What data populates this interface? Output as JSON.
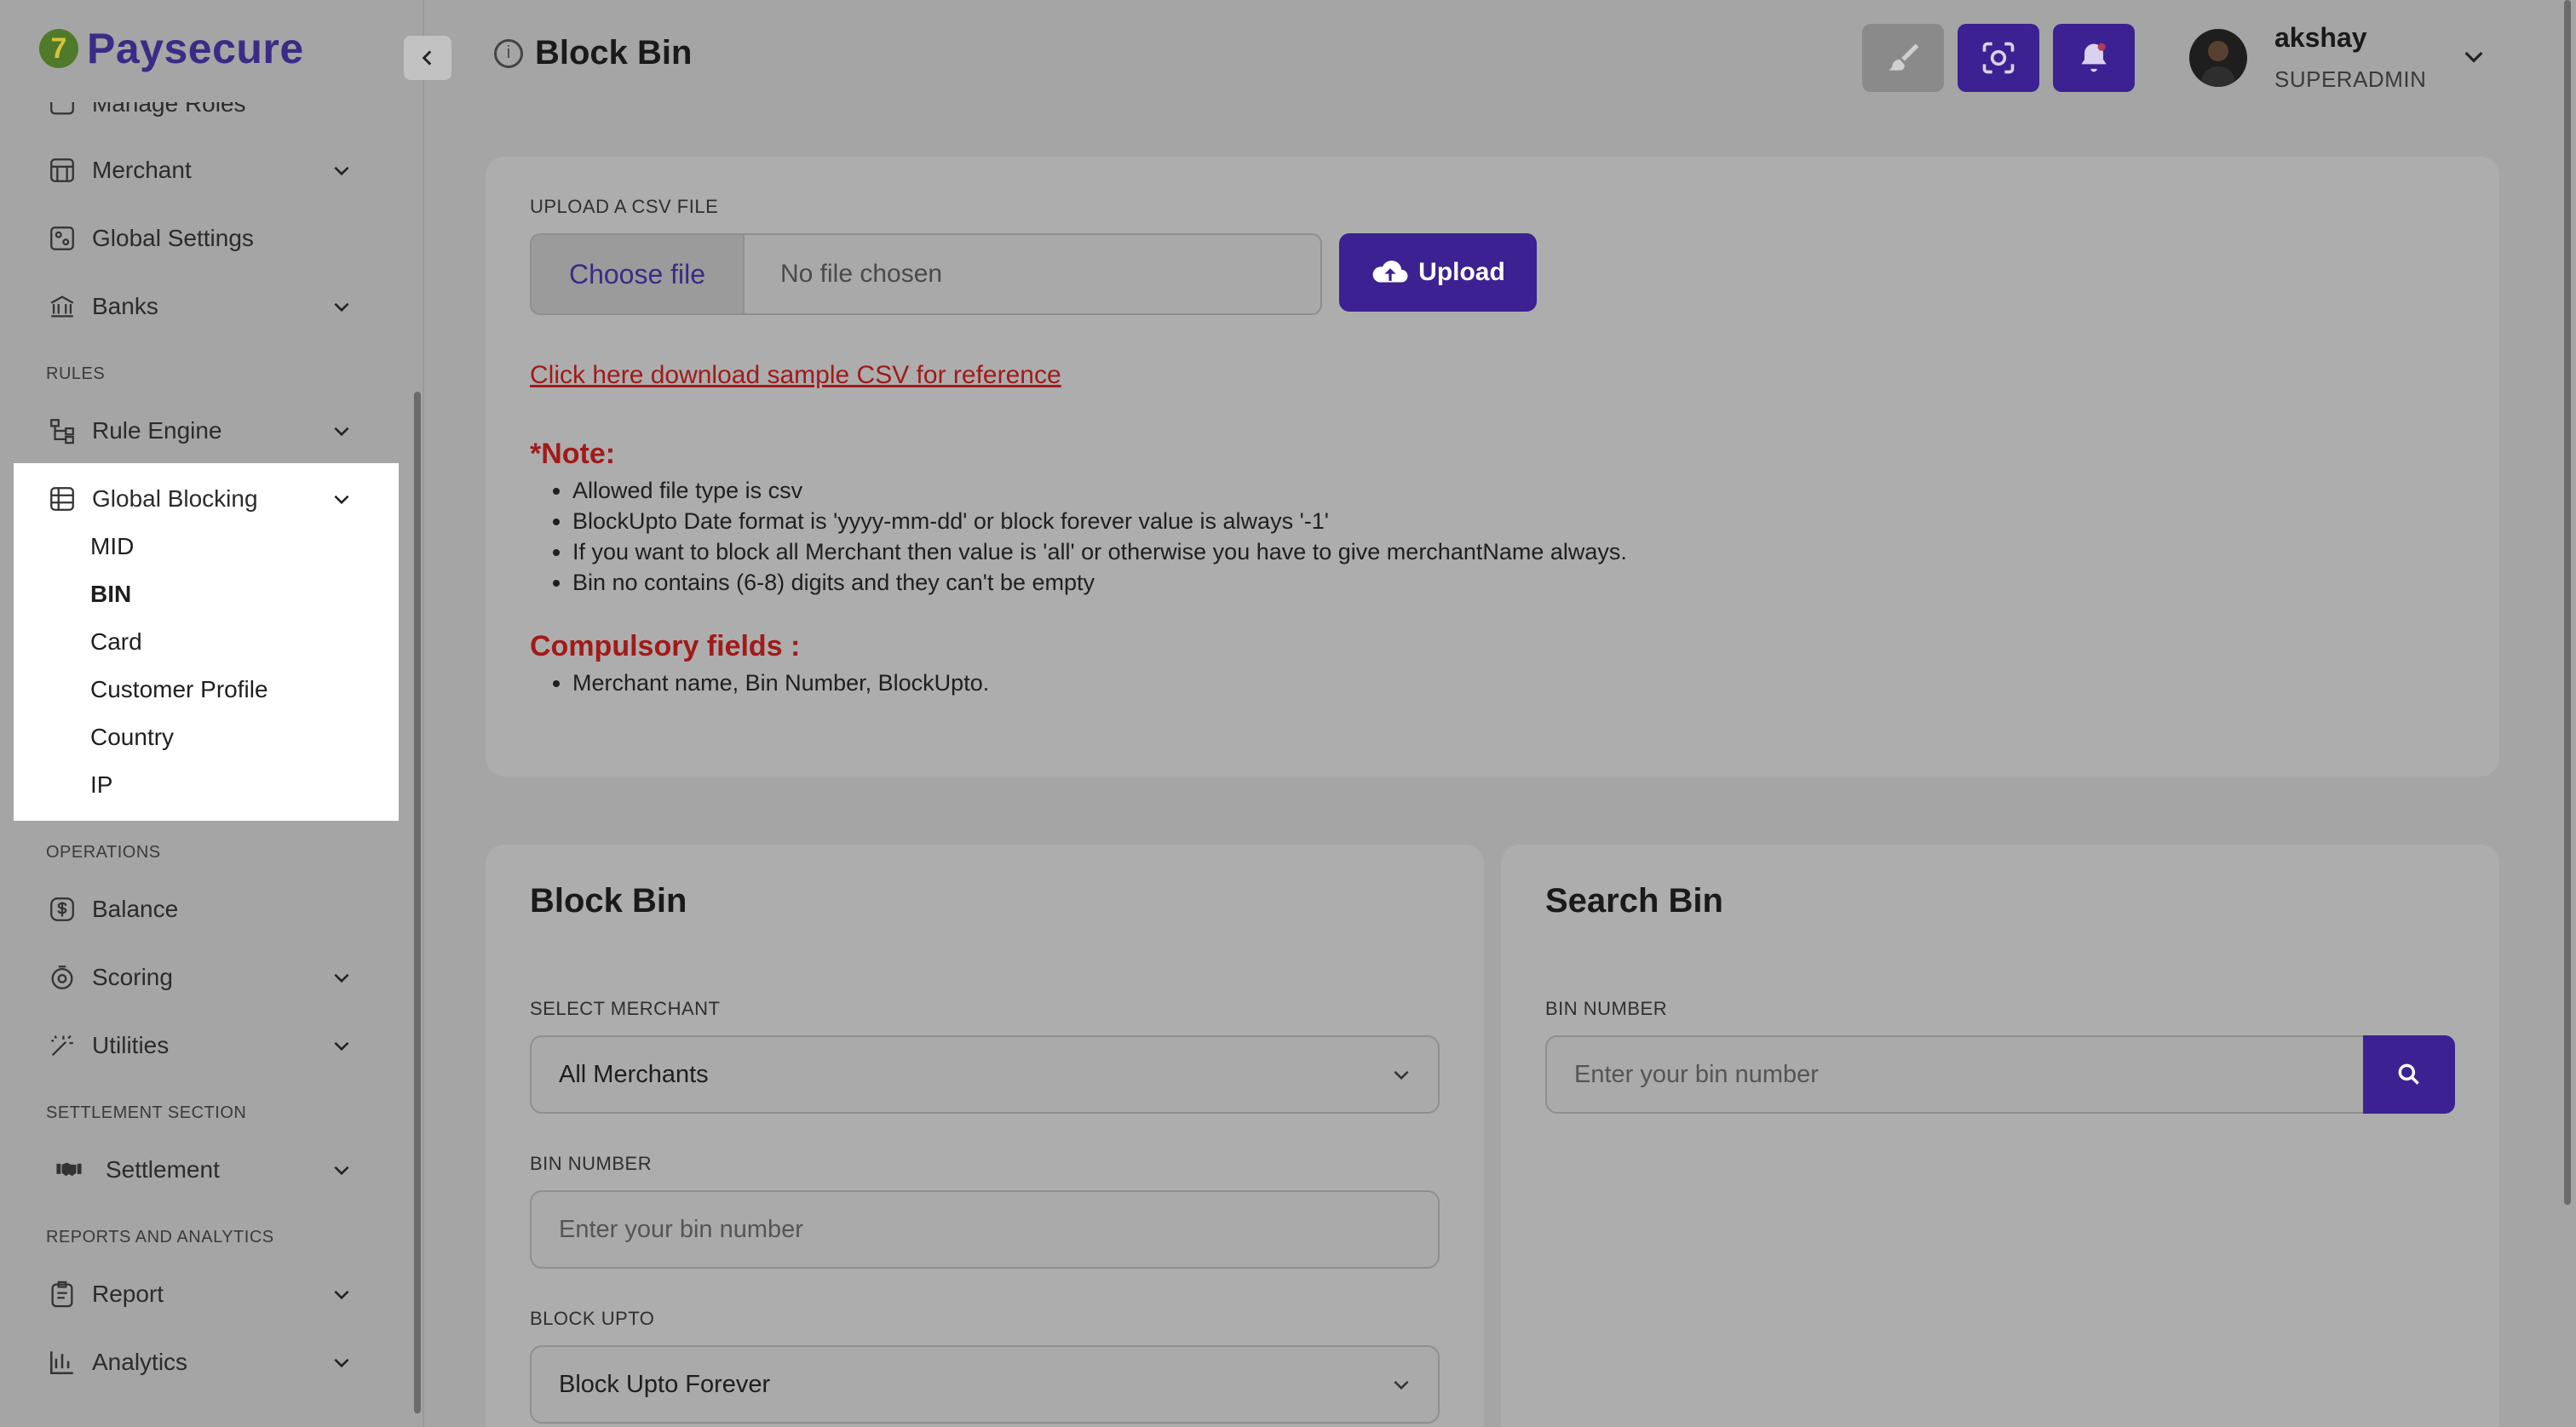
{
  "brand": {
    "name": "Paysecure"
  },
  "sidebar": {
    "items": [
      {
        "label": "Manage Roles"
      },
      {
        "label": "Merchant"
      },
      {
        "label": "Global Settings"
      },
      {
        "label": "Banks"
      },
      {
        "label": "Rule Engine"
      },
      {
        "label": "Global Blocking"
      },
      {
        "label": "Balance"
      },
      {
        "label": "Scoring"
      },
      {
        "label": "Utilities"
      },
      {
        "label": "Settlement"
      },
      {
        "label": "Report"
      },
      {
        "label": "Analytics"
      }
    ],
    "sections": {
      "rules": "RULES",
      "operations": "OPERATIONS",
      "settlement": "SETTLEMENT SECTION",
      "reports": "REPORTS AND ANALYTICS"
    },
    "global_blocking_sub": [
      "MID",
      "BIN",
      "Card",
      "Customer Profile",
      "Country",
      "IP"
    ],
    "active_sub": "BIN"
  },
  "header": {
    "title": "Block Bin",
    "user": {
      "name": "akshay",
      "role": "SUPERADMIN"
    }
  },
  "upload": {
    "label": "UPLOAD A CSV FILE",
    "choose_label": "Choose file",
    "no_file": "No file chosen",
    "button": "Upload",
    "download_link": "Click here download sample CSV for reference"
  },
  "note": {
    "title": "*Note:",
    "items": [
      "Allowed file type is csv",
      "BlockUpto Date format is 'yyyy-mm-dd' or block forever value is always '-1'",
      "If you want to block all Merchant then value is 'all' or otherwise you have to give merchantName always.",
      "Bin no contains (6-8) digits and they can't be empty"
    ]
  },
  "compulsory": {
    "title": "Compulsory fields :",
    "items": [
      "Merchant name, Bin Number, BlockUpto."
    ]
  },
  "block_bin": {
    "title": "Block Bin",
    "merchant_label": "SELECT MERCHANT",
    "merchant_value": "All Merchants",
    "bin_label": "BIN NUMBER",
    "bin_placeholder": "Enter your bin number",
    "upto_label": "BLOCK UPTO",
    "upto_value": "Block Upto Forever"
  },
  "search_bin": {
    "title": "Search Bin",
    "bin_label": "BIN NUMBER",
    "bin_placeholder": "Enter your bin number"
  },
  "colors": {
    "accent": "#3b2191",
    "brand": "#3b2b86",
    "alert": "#a11a1a",
    "overlay_bg": "#a5a5a5"
  }
}
